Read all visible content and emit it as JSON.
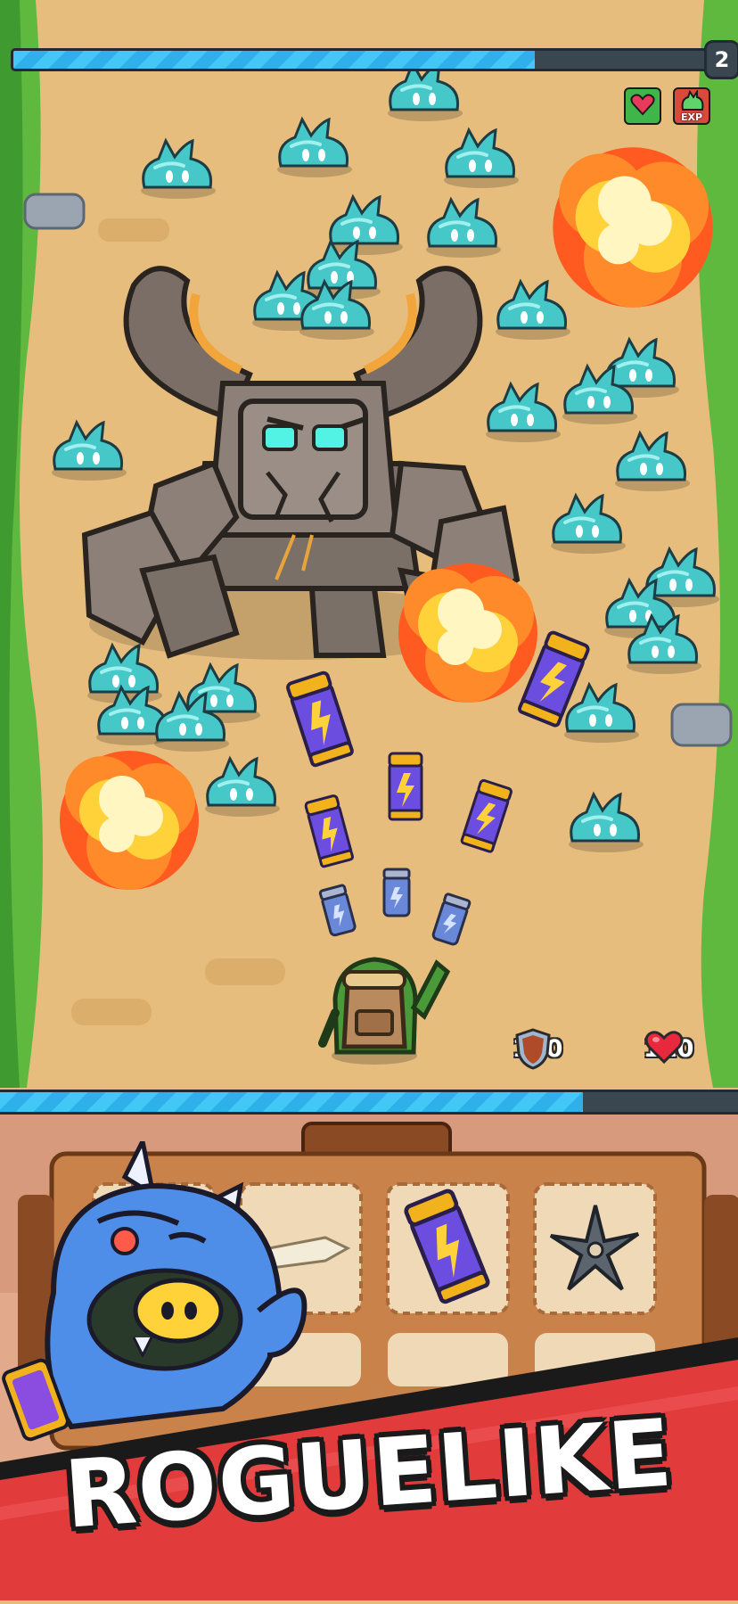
{
  "hud": {
    "wave_level": "2",
    "wave_progress": 0.75,
    "buffs": [
      {
        "icon": "heart-heal-icon",
        "label": ""
      },
      {
        "icon": "exp-boost-icon",
        "label": "EXP"
      }
    ],
    "armor_value": "110",
    "health_value": "110",
    "xp_progress": 0.79
  },
  "inventory": {
    "slots": [
      {
        "icon": "sword-icon"
      },
      {
        "icon": "lightning-grenade-icon"
      },
      {
        "icon": "shuriken-icon"
      }
    ]
  },
  "banner": {
    "title": "ROGUELIKE"
  },
  "colors": {
    "path": "#e7bd7e",
    "grass": "#6cc24a",
    "slime": "#43c6c9",
    "bar_fill": "#43c7f6",
    "banner_red": "#e23b3b"
  }
}
